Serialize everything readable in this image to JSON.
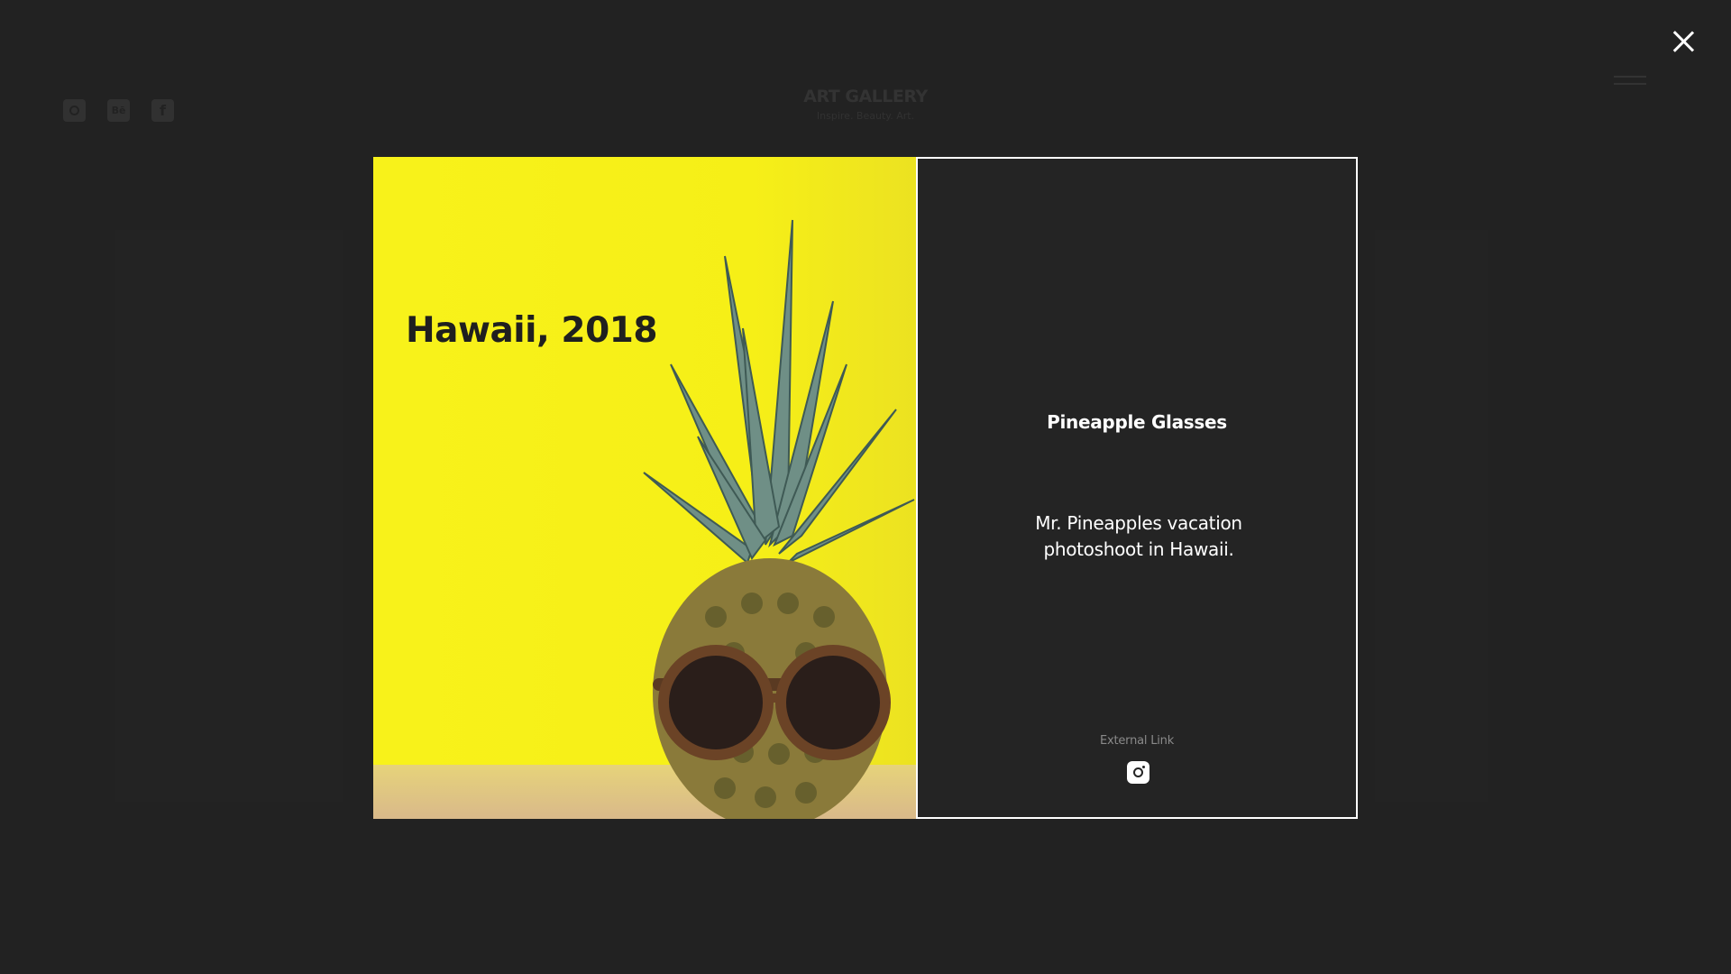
{
  "header": {
    "brand_title": "ART GALLERY",
    "brand_tagline": "Inspire. Beauty. Art.",
    "social_icons": [
      "instagram-icon",
      "behance-icon",
      "facebook-icon"
    ],
    "behance_glyph": "Bē",
    "facebook_glyph": "f"
  },
  "modal": {
    "image_caption": "Hawaii, 2018",
    "title": "Pineapple Glasses",
    "description": "Mr. Pineapples vacation photoshoot in Hawaii.",
    "link_label": "External Link",
    "link_icon": "instagram-icon"
  },
  "colors": {
    "background": "#222222",
    "accent_yellow": "#f8f21a",
    "text": "#ffffff",
    "muted": "#8a8a8a"
  }
}
